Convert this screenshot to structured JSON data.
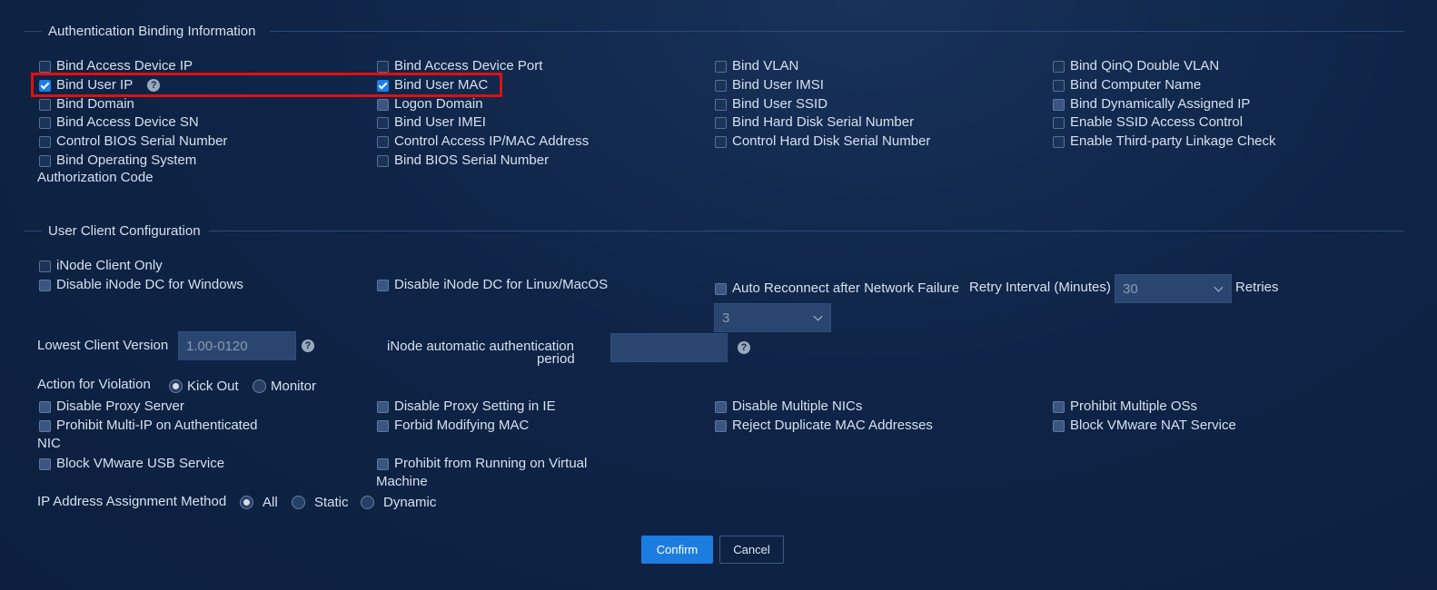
{
  "auth": {
    "title": "Authentication Binding Information",
    "col1": [
      {
        "label": "Bind Access Device IP",
        "state": "unchecked"
      },
      {
        "label": "Bind User IP",
        "state": "checked"
      },
      {
        "label": "Bind Domain",
        "state": "unchecked"
      },
      {
        "label": "Bind Access Device SN",
        "state": "unchecked"
      },
      {
        "label": "Control BIOS Serial Number",
        "state": "unchecked"
      },
      {
        "label": "Bind Operating System",
        "state": "unchecked"
      }
    ],
    "col1_extra": "Authorization Code",
    "col2": [
      {
        "label": "Bind Access Device Port",
        "state": "unchecked"
      },
      {
        "label": "Bind User MAC",
        "state": "checked"
      },
      {
        "label": "Logon Domain",
        "state": "filled"
      },
      {
        "label": "Bind User IMEI",
        "state": "unchecked"
      },
      {
        "label": "Control Access IP/MAC Address",
        "state": "unchecked"
      },
      {
        "label": "Bind BIOS Serial Number",
        "state": "unchecked"
      }
    ],
    "col3": [
      {
        "label": "Bind VLAN",
        "state": "unchecked"
      },
      {
        "label": "Bind User IMSI",
        "state": "unchecked"
      },
      {
        "label": "Bind User SSID",
        "state": "unchecked"
      },
      {
        "label": "Bind Hard Disk Serial Number",
        "state": "unchecked"
      },
      {
        "label": "Control Hard Disk Serial Number",
        "state": "unchecked"
      }
    ],
    "col4": [
      {
        "label": "Bind QinQ Double VLAN",
        "state": "unchecked"
      },
      {
        "label": "Bind Computer Name",
        "state": "unchecked"
      },
      {
        "label": "Bind Dynamically Assigned IP",
        "state": "filled"
      },
      {
        "label": "Enable SSID Access Control",
        "state": "unchecked"
      },
      {
        "label": "Enable Third-party Linkage Check",
        "state": "unchecked"
      }
    ],
    "help": "?"
  },
  "client": {
    "title": "User Client Configuration",
    "inode_only": "iNode Client Only",
    "disable_dc_windows": "Disable iNode DC for Windows",
    "disable_dc_linux": "Disable iNode DC for Linux/MacOS",
    "auto_reconnect": "Auto Reconnect after Network Failure",
    "retry_interval_label": "Retry Interval (Minutes)",
    "retry_interval_value": "30",
    "retries_label": "Retries",
    "retries_value": "3",
    "lowest_version_label": "Lowest Client Version",
    "lowest_version_value": "1.00-0120",
    "auto_auth_label_1": "iNode automatic authentication",
    "auto_auth_label_2": "period",
    "auto_auth_value": "",
    "action_label": "Action for Violation",
    "kick_out": "Kick Out",
    "monitor": "Monitor",
    "row_a": [
      "Disable Proxy Server",
      "Disable Proxy Setting in IE",
      "Disable Multiple NICs",
      "Prohibit Multiple OSs"
    ],
    "row_b_1": "Prohibit Multi-IP on Authenticated",
    "row_b_1_cont": "NIC",
    "row_b": [
      "Forbid Modifying MAC",
      "Reject Duplicate MAC Addresses",
      "Block VMware NAT Service"
    ],
    "row_c_1": "Block VMware USB Service",
    "row_c_2": "Prohibit from Running on Virtual",
    "row_c_2_cont": "Machine",
    "ip_method_label": "IP Address Assignment Method",
    "ip_all": "All",
    "ip_static": "Static",
    "ip_dynamic": "Dynamic",
    "help": "?"
  },
  "buttons": {
    "confirm": "Confirm",
    "cancel": "Cancel"
  },
  "colors": {
    "accent": "#1d7ce0",
    "highlight": "#e01010",
    "background": "#0f2447"
  }
}
